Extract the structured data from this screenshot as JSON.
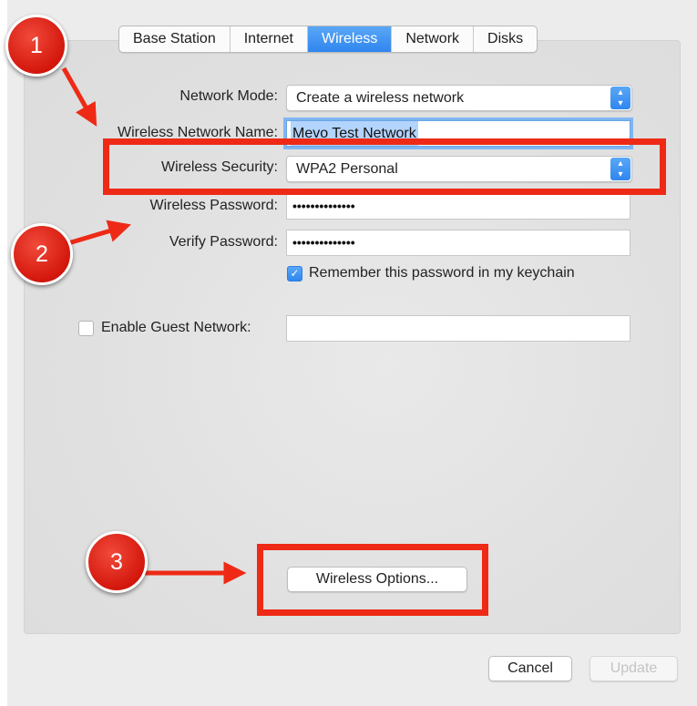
{
  "tabs": [
    {
      "label": "Base Station"
    },
    {
      "label": "Internet"
    },
    {
      "label": "Wireless"
    },
    {
      "label": "Network"
    },
    {
      "label": "Disks"
    }
  ],
  "active_tab": "Wireless",
  "form": {
    "network_mode": {
      "label": "Network Mode:",
      "value": "Create a wireless network"
    },
    "network_name": {
      "label": "Wireless Network Name:",
      "value": "Mevo Test Network"
    },
    "security": {
      "label": "Wireless Security:",
      "value": "WPA2 Personal"
    },
    "password": {
      "label": "Wireless Password:",
      "value": "••••••••••••••"
    },
    "verify": {
      "label": "Verify Password:",
      "value": "••••••••••••••"
    },
    "keychain": {
      "label": "Remember this password in my keychain",
      "checked": true
    },
    "guest": {
      "label": "Enable Guest Network:",
      "checked": false,
      "value": ""
    }
  },
  "buttons": {
    "wireless_options": "Wireless Options...",
    "cancel": "Cancel",
    "update": "Update"
  },
  "annotations": {
    "badge_1": "1",
    "badge_2": "2",
    "badge_3": "3"
  },
  "colors": {
    "accent": "#2f86ef",
    "highlight": "#ee2a16"
  }
}
